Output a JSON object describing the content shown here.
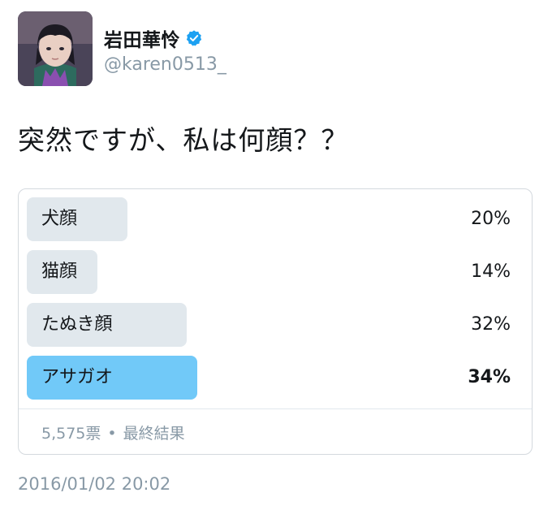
{
  "user": {
    "display_name": "岩田華怜",
    "handle": "@karen0513_",
    "verified": true,
    "verified_color": "#1da1f2"
  },
  "tweet": {
    "text": "突然ですが、私は何顔？？",
    "timestamp": "2016/01/02 20:02"
  },
  "poll": {
    "options": [
      {
        "label": "犬顔",
        "percent_text": "20%",
        "percent": 20,
        "winner": false
      },
      {
        "label": "猫顔",
        "percent_text": "14%",
        "percent": 14,
        "winner": false
      },
      {
        "label": "たぬき顔",
        "percent_text": "32%",
        "percent": 32,
        "winner": false
      },
      {
        "label": "アサガオ",
        "percent_text": "34%",
        "percent": 34,
        "winner": true
      }
    ],
    "votes": "5,575票",
    "separator": "•",
    "status": "最終結果",
    "bar_color": "#e1e8ed",
    "winner_color": "#71c9f8"
  }
}
